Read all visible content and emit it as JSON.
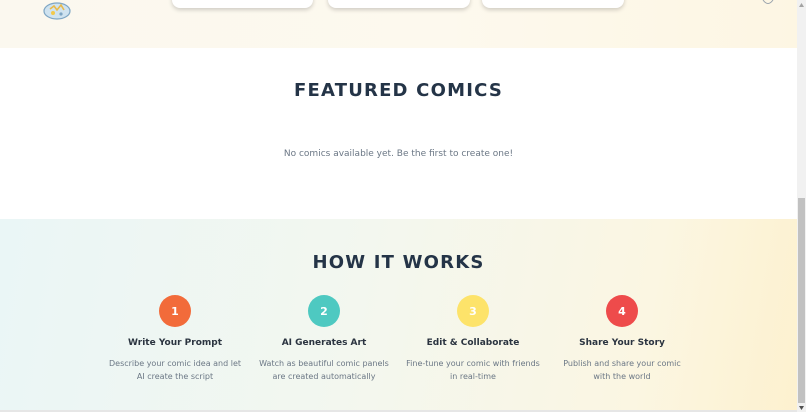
{
  "featured": {
    "title": "Featured Comics",
    "empty_message": "No comics available yet. Be the first to create one!"
  },
  "how_it_works": {
    "title": "How It Works",
    "steps": [
      {
        "number": "1",
        "title": "Write Your Prompt",
        "description": "Describe your comic idea and let AI create the script",
        "color": "#f26b3a"
      },
      {
        "number": "2",
        "title": "AI Generates Art",
        "description": "Watch as beautiful comic panels are created automatically",
        "color": "#4ec9c1"
      },
      {
        "number": "3",
        "title": "Edit & Collaborate",
        "description": "Fine-tune your comic with friends in real-time",
        "color": "#fde36a"
      },
      {
        "number": "4",
        "title": "Share Your Story",
        "description": "Publish and share your comic with the world",
        "color": "#ee4b4b"
      }
    ]
  },
  "icons": {
    "sticker": "comic-sticker-icon",
    "corner": "chat-bubble-icon"
  }
}
